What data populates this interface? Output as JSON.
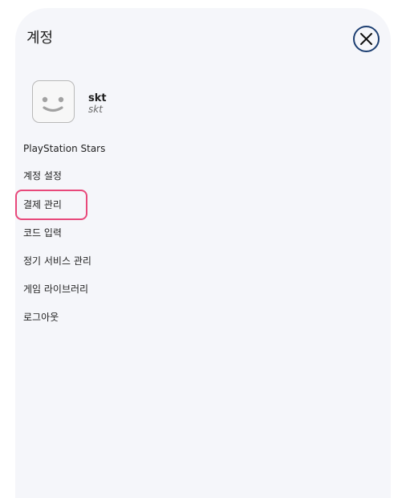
{
  "header": {
    "title": "계정",
    "close_icon": "close-icon"
  },
  "profile": {
    "avatar_icon": "smiley-face-icon",
    "username": "skt",
    "user_id": "skt"
  },
  "menu": {
    "items": [
      {
        "label": "PlayStation Stars"
      },
      {
        "label": "계정 설정"
      },
      {
        "label": "결제 관리",
        "highlighted": true
      },
      {
        "label": "코드 입력"
      },
      {
        "label": "정기 서비스 관리"
      },
      {
        "label": "게임 라이브러리"
      },
      {
        "label": "로그아웃"
      }
    ]
  },
  "colors": {
    "panel_background": "#f5f6fa",
    "close_button_accent": "#1d3f72",
    "highlight_border": "#e8487a"
  }
}
